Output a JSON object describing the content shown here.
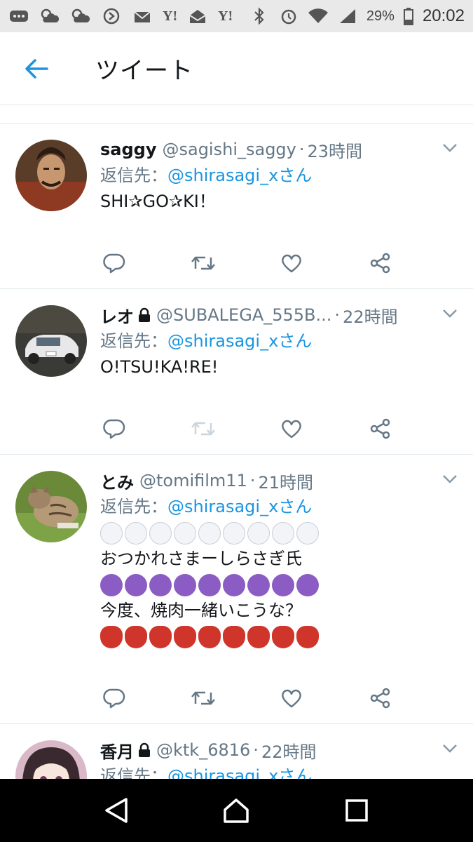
{
  "status_bar": {
    "left_icons": [
      "more-icon",
      "weather-icon",
      "weather-icon",
      "app-icon",
      "mail-icon",
      "yahoo-icon",
      "mail-icon",
      "yahoo-icon"
    ],
    "yahoo_label": "Y!",
    "battery": "29%",
    "time": "20:02"
  },
  "header": {
    "title": "ツイート"
  },
  "reply_prefix": "返信先：",
  "tweets": [
    {
      "name": "saggy",
      "locked": false,
      "handle": "@sagishi_saggy",
      "time": "23時間",
      "mention": "@shirasagi_xさん",
      "text": "SHI✰GO✰KI！"
    },
    {
      "name": "レオ",
      "locked": true,
      "handle": "@SUBALEGA_555B...",
      "time": "22時間",
      "mention": "@shirasagi_xさん",
      "text": "O!TSU!KA!RE!"
    },
    {
      "name": "とみ",
      "locked": false,
      "handle": "@tomifilm11",
      "time": "21時間",
      "mention": "@shirasagi_xさん",
      "line1": "おつかれさまーしらさぎ氏",
      "line2": "今度、焼肉一緒いこうな？"
    },
    {
      "name": "香月",
      "locked": true,
      "handle": "@ktk_6816",
      "time": "22時間",
      "mention": "@shirasagi_xさん"
    }
  ],
  "colors": {
    "accent": "#1b95e0",
    "muted": "#657786",
    "text": "#14171a",
    "divider": "#e1e8ed"
  }
}
